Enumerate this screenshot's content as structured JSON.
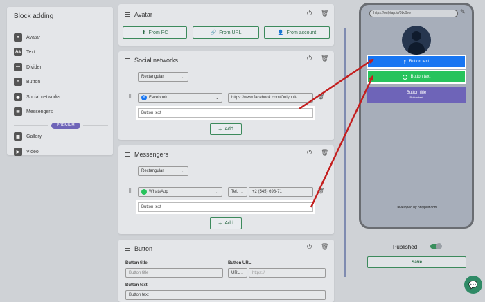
{
  "sidebar": {
    "title": "Block adding",
    "items": [
      {
        "label": "Avatar",
        "icon": "avatar-icon",
        "glyph": "●"
      },
      {
        "label": "Text",
        "icon": "text-icon",
        "glyph": "Aa"
      },
      {
        "label": "Divider",
        "icon": "divider-icon",
        "glyph": "—"
      },
      {
        "label": "Button",
        "icon": "button-icon",
        "glyph": "+"
      },
      {
        "label": "Social networks",
        "icon": "social-icon",
        "glyph": "◉"
      },
      {
        "label": "Messengers",
        "icon": "messenger-icon",
        "glyph": "✉"
      }
    ],
    "premium_label": "PREMIUM",
    "premium_items": [
      {
        "label": "Gallery",
        "icon": "gallery-icon",
        "glyph": "▦"
      },
      {
        "label": "Video",
        "icon": "video-icon",
        "glyph": "▶"
      }
    ]
  },
  "avatar_panel": {
    "title": "Avatar",
    "buttons": [
      "From PC",
      "From URL",
      "From account"
    ]
  },
  "social_panel": {
    "title": "Social networks",
    "style": "Rectangular",
    "network": "Facebook",
    "url": "https://www.facebook.com/Onlypult/",
    "button_text": "Button text",
    "add_label": "Add"
  },
  "messengers_panel": {
    "title": "Messengers",
    "style": "Rectangular",
    "messenger": "WhatsApp",
    "type": "Tel.",
    "phone": "+2 (545) 698-71",
    "button_text": "Button text",
    "add_label": "Add"
  },
  "button_panel": {
    "title": "Button",
    "title_label": "Button title",
    "title_placeholder": "Button title",
    "url_label": "Button URL",
    "url_type": "URL",
    "url_placeholder": "https://",
    "text_label": "Button text",
    "text_value": "Button text"
  },
  "preview": {
    "url": "https://onlytap.io/0bc9rw",
    "fb_button": "Button text",
    "wa_button": "Button text",
    "custom_title": "Button title",
    "custom_text": "Button text",
    "footer": "Developed by onlypult.com"
  },
  "published_label": "Published",
  "save_label": "Save",
  "colors": {
    "accent": "#3c8a5c",
    "facebook": "#1876f2",
    "whatsapp": "#27c35c",
    "premium": "#6e64b8",
    "arrow": "#c41e1e"
  }
}
